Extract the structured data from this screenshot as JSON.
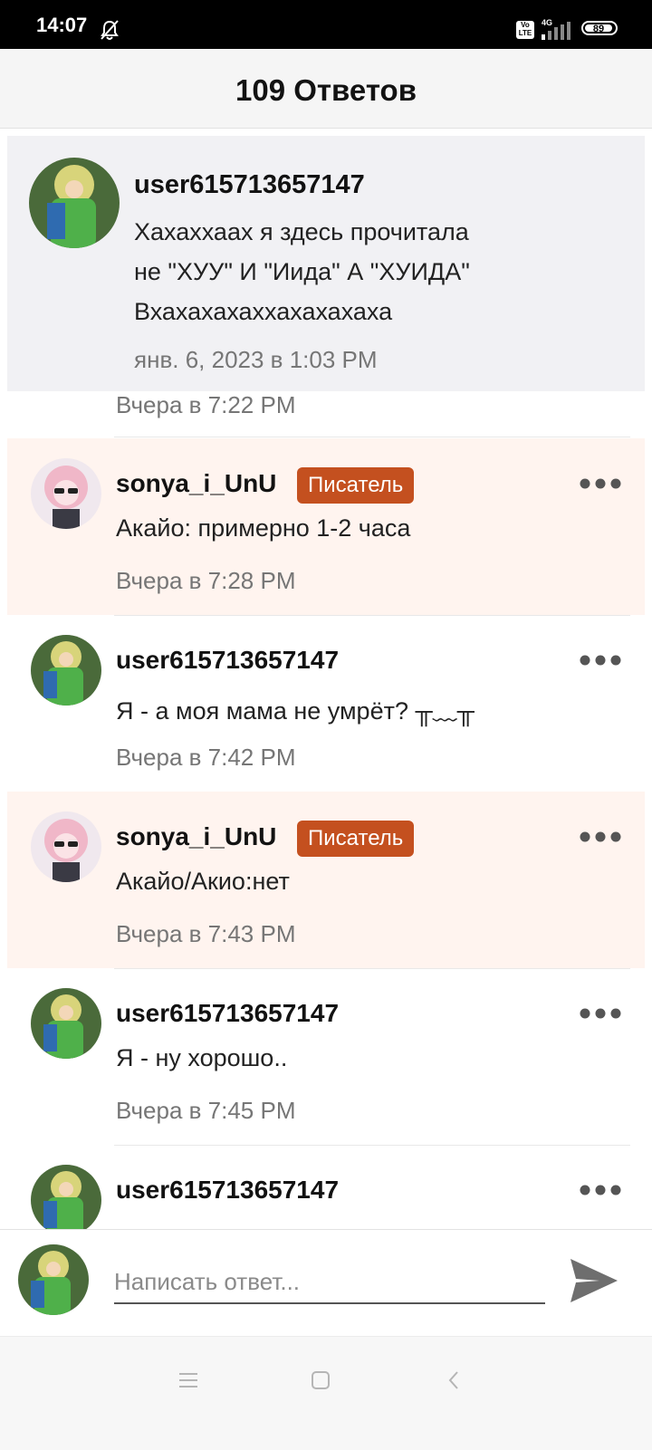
{
  "status_bar": {
    "time": "14:07",
    "volte": "Vo LTE",
    "network": "4G",
    "battery": "89",
    "icons": [
      "bell-off-icon",
      "volte-icon",
      "signal-icon",
      "battery-icon"
    ]
  },
  "header": {
    "title": "109 Ответов"
  },
  "parent_comment": {
    "username": "user615713657147",
    "text_lines": [
      "Хахаххаах я здесь прочитала",
      "не \"ХУУ\" И \"Иида\" А \"ХУИДА\"",
      "Вхахахахаххахахахаха"
    ],
    "time": "янв. 6, 2023 в 1:03 PM"
  },
  "previous_reply_time": "Вчера в 7:22 PM",
  "comments": [
    {
      "username": "sonya_i_UnU",
      "badge": "Писатель",
      "text": "Акайо: примерно 1-2 часа",
      "time": "Вчера в 7:28 PM"
    },
    {
      "username": "user615713657147",
      "text": "Я - а моя мама не умрёт? ╥﹏╥",
      "time": "Вчера в 7:42 PM"
    },
    {
      "username": "sonya_i_UnU",
      "badge": "Писатель",
      "text": "Акайо/Акио:нет",
      "time": "Вчера в 7:43 PM"
    },
    {
      "username": "user615713657147",
      "text": "Я - ну хорошо..",
      "time": "Вчера в 7:45 PM"
    },
    {
      "username": "user615713657147"
    }
  ],
  "reply_input": {
    "placeholder": "Написать ответ...",
    "value": ""
  },
  "nav": {
    "icons": [
      "menu-icon",
      "home-square-icon",
      "back-icon"
    ]
  },
  "colors": {
    "writer_badge": "#c4501f",
    "writer_row_bg": "#fff4ef",
    "parent_bg": "#f1f1f4"
  }
}
